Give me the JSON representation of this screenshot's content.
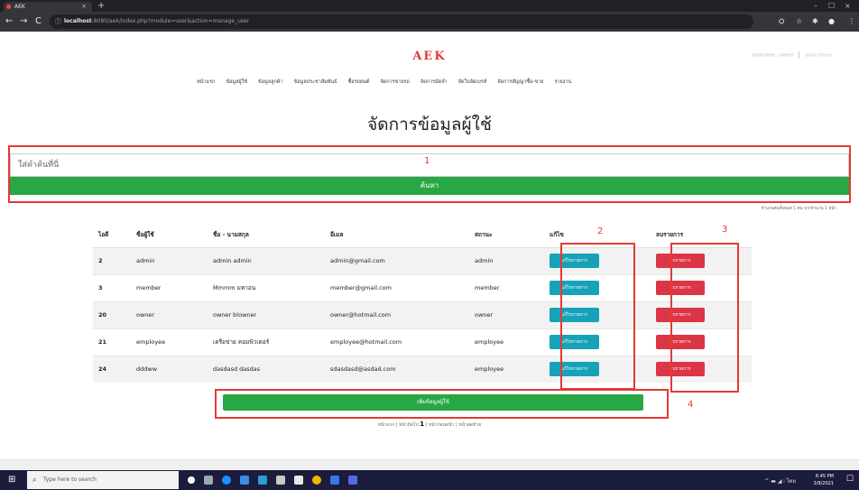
{
  "browser": {
    "tab_title": "AEK",
    "tab_close": "×",
    "new_tab": "+",
    "url_host": "localhost",
    "url_path": ":8080/aek/index.php?module=user&action=manage_user",
    "back": "←",
    "forward": "→",
    "reload": "C",
    "info_icon": "ⓘ",
    "minimize": "–",
    "maximize": "☐",
    "close": "×"
  },
  "header": {
    "logo": "AEK",
    "username_label": "Username : owner",
    "logout": "ออกจากระบบ"
  },
  "nav": [
    "หน้าแรก",
    "ข้อมูลผู้ใช้",
    "ข้อมูลลูกค้า",
    "ข้อมูลประชาสัมพันธ์",
    "ซื้อรถยนต์",
    "จัดการขายรถ",
    "จัดการมัดจำ",
    "จัดใบจัดเบรห์",
    "จัดการสัญญาซื้อ-ขาย",
    "รายงาน"
  ],
  "page_title": "จัดการข้อมูลผู้ใช้",
  "search": {
    "placeholder": "ใส่คำค้นที่นี่",
    "button": "ค้นหา"
  },
  "count_text": "จำนวนคนทั้งหมด 5 คน จากจำนวน 1 หน้า",
  "table": {
    "headers": [
      "ไอดี",
      "ชื่อผู้ใช้",
      "ชื่อ - นามสกุล",
      "อีเมล",
      "สถานะ",
      "แก้ไข",
      "ลบรายการ"
    ],
    "rows": [
      {
        "id": "2",
        "username": "admin",
        "fullname": "admin admin",
        "email": "admin@gmail.com",
        "status": "admin"
      },
      {
        "id": "3",
        "username": "member",
        "fullname": "Mmmm มหาอน",
        "email": "member@gmail.com",
        "status": "member"
      },
      {
        "id": "20",
        "username": "owner",
        "fullname": "owner blowner",
        "email": "owner@hotmail.com",
        "status": "owner"
      },
      {
        "id": "21",
        "username": "employee",
        "fullname": "เครือข่าย คอมพิวเตอร์",
        "email": "employee@hotmail.com",
        "status": "employee"
      },
      {
        "id": "24",
        "username": "dddww",
        "fullname": "dasdasd dasdas",
        "email": "sdasdasd@asdad.com",
        "status": "employee"
      }
    ],
    "edit_label": "แก้ไขรายการ",
    "delete_label": "ลบรายการ"
  },
  "add_button": "เพิ่มข้อมูลผู้ใช้",
  "pager": {
    "first": "หน้าแรก | หน้าถัดไป",
    "current": "1",
    "rest": "| หน้าก่อนหน้า | หน้าสุดท้าย"
  },
  "annotations": [
    "1",
    "2",
    "3",
    "4"
  ],
  "taskbar": {
    "start": "⊞",
    "search_icon": "⌕",
    "search_placeholder": "Type here to search",
    "tray_icons": "^  ▬  ◢  ⧘  ไทย",
    "time": "6:45 PM",
    "date": "3/9/2021",
    "notification_icon": "☐"
  },
  "colors": {
    "green": "#28a745",
    "edit": "#17a2b8",
    "delete": "#dc3545",
    "annotation": "#e53935"
  }
}
